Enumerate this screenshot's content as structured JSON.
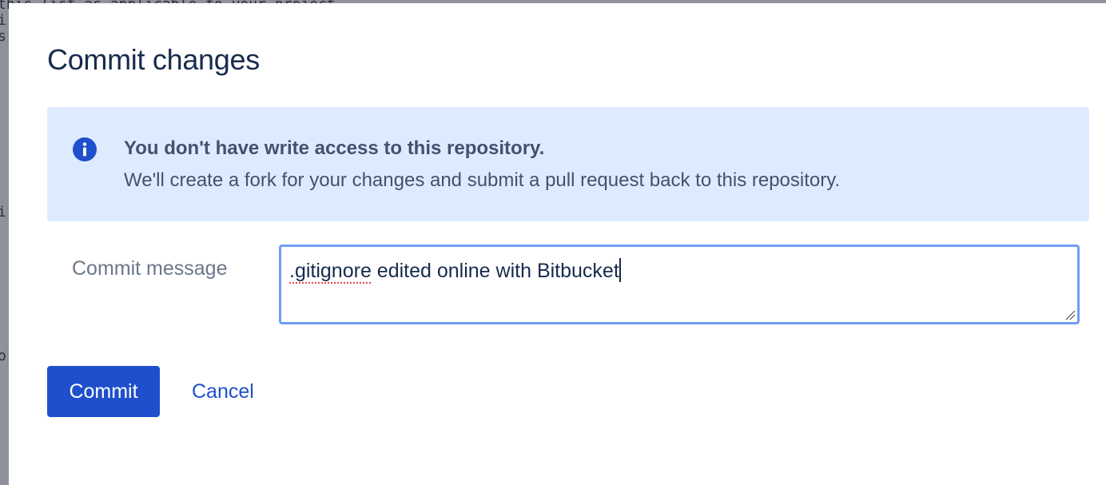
{
  "background": {
    "code_lines": [
      "this list as applicable to your project",
      "i",
      "s",
      "",
      "",
      "",
      "",
      "",
      "",
      "",
      "",
      "",
      "",
      "i",
      "",
      "",
      "",
      "",
      "",
      "",
      "",
      "",
      "o"
    ]
  },
  "modal": {
    "title": "Commit changes",
    "info": {
      "icon": "info-icon",
      "title": "You don't have write access to this repository.",
      "text": "We'll create a fork for your changes and submit a pull request back to this repository."
    },
    "commit_message": {
      "label": "Commit message",
      "value_misspelled": ".gitignore",
      "value_rest": " edited online with Bitbucket"
    },
    "buttons": {
      "commit": "Commit",
      "cancel": "Cancel"
    }
  },
  "colors": {
    "primary": "#1f4fcc",
    "info_bg": "#deebff",
    "focus_border": "#6d9ef1",
    "title_text": "#172b4d"
  }
}
